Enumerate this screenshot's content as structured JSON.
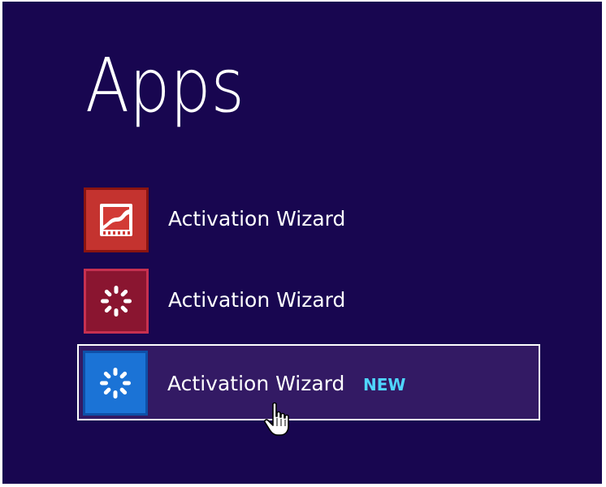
{
  "page": {
    "title": "Apps"
  },
  "apps": [
    {
      "label": "Activation Wizard",
      "icon": "video-editor-icon",
      "tile_color": "#c4332f",
      "border_color": "#8a1410"
    },
    {
      "label": "Activation Wizard",
      "icon": "loading-spinner-icon",
      "tile_color": "#8a1530",
      "border_color": "#c73050"
    },
    {
      "label": "Activation Wizard",
      "icon": "loading-spinner-icon",
      "tile_color": "#1b73d6",
      "border_color": "#0e50a8",
      "badge": "NEW",
      "selected": true
    }
  ],
  "colors": {
    "background": "#180650",
    "selection_fill": "#331a64",
    "selection_border": "#ffffff",
    "badge_text": "#4fd6ff"
  },
  "cursor": {
    "icon": "hand-pointer-icon"
  }
}
